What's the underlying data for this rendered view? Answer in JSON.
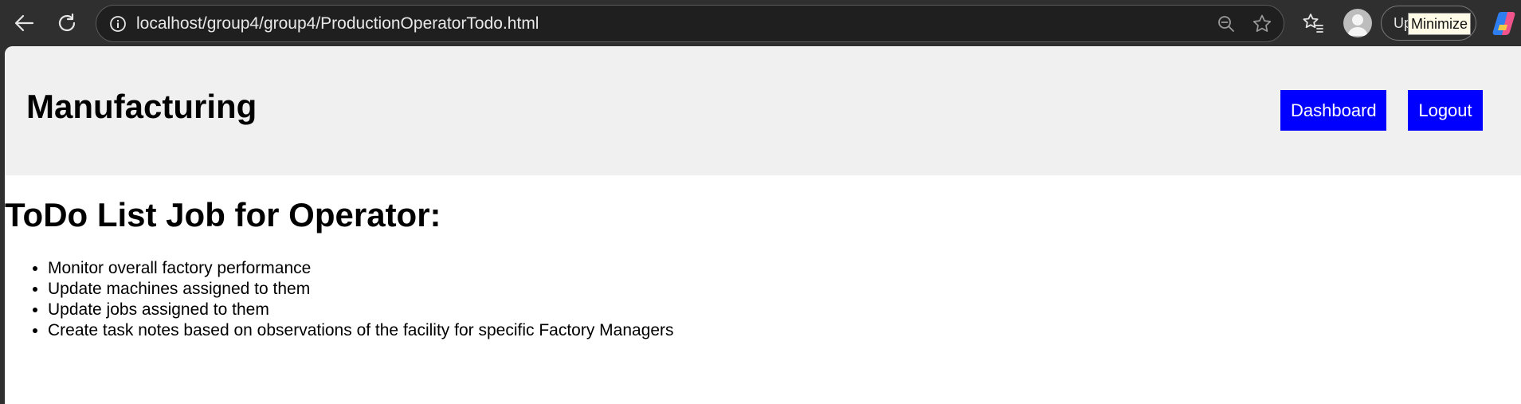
{
  "browser": {
    "url": "localhost/group4/group4/ProductionOperatorTodo.html",
    "update_label": "Up",
    "tooltip": "Minimize",
    "icons": {
      "back": "back-arrow-icon",
      "reload": "reload-icon",
      "site_info": "info-icon",
      "zoom": "zoom-out-icon",
      "favorite": "star-icon",
      "favorites": "favorites-list-icon",
      "profile": "avatar",
      "copilot": "copilot-icon"
    }
  },
  "header": {
    "title": "Manufacturing",
    "nav": {
      "dashboard_label": "Dashboard",
      "logout_label": "Logout"
    },
    "colors": {
      "header_bg": "#f0f0f0",
      "button_bg": "#0000ff",
      "button_text": "#ffffff"
    }
  },
  "main": {
    "heading": "ToDo List Job for Operator:",
    "tasks": [
      "Monitor overall factory performance",
      "Update machines assigned to them",
      "Update jobs assigned to them",
      "Create task notes based on observations of the facility for specific Factory Managers"
    ]
  }
}
